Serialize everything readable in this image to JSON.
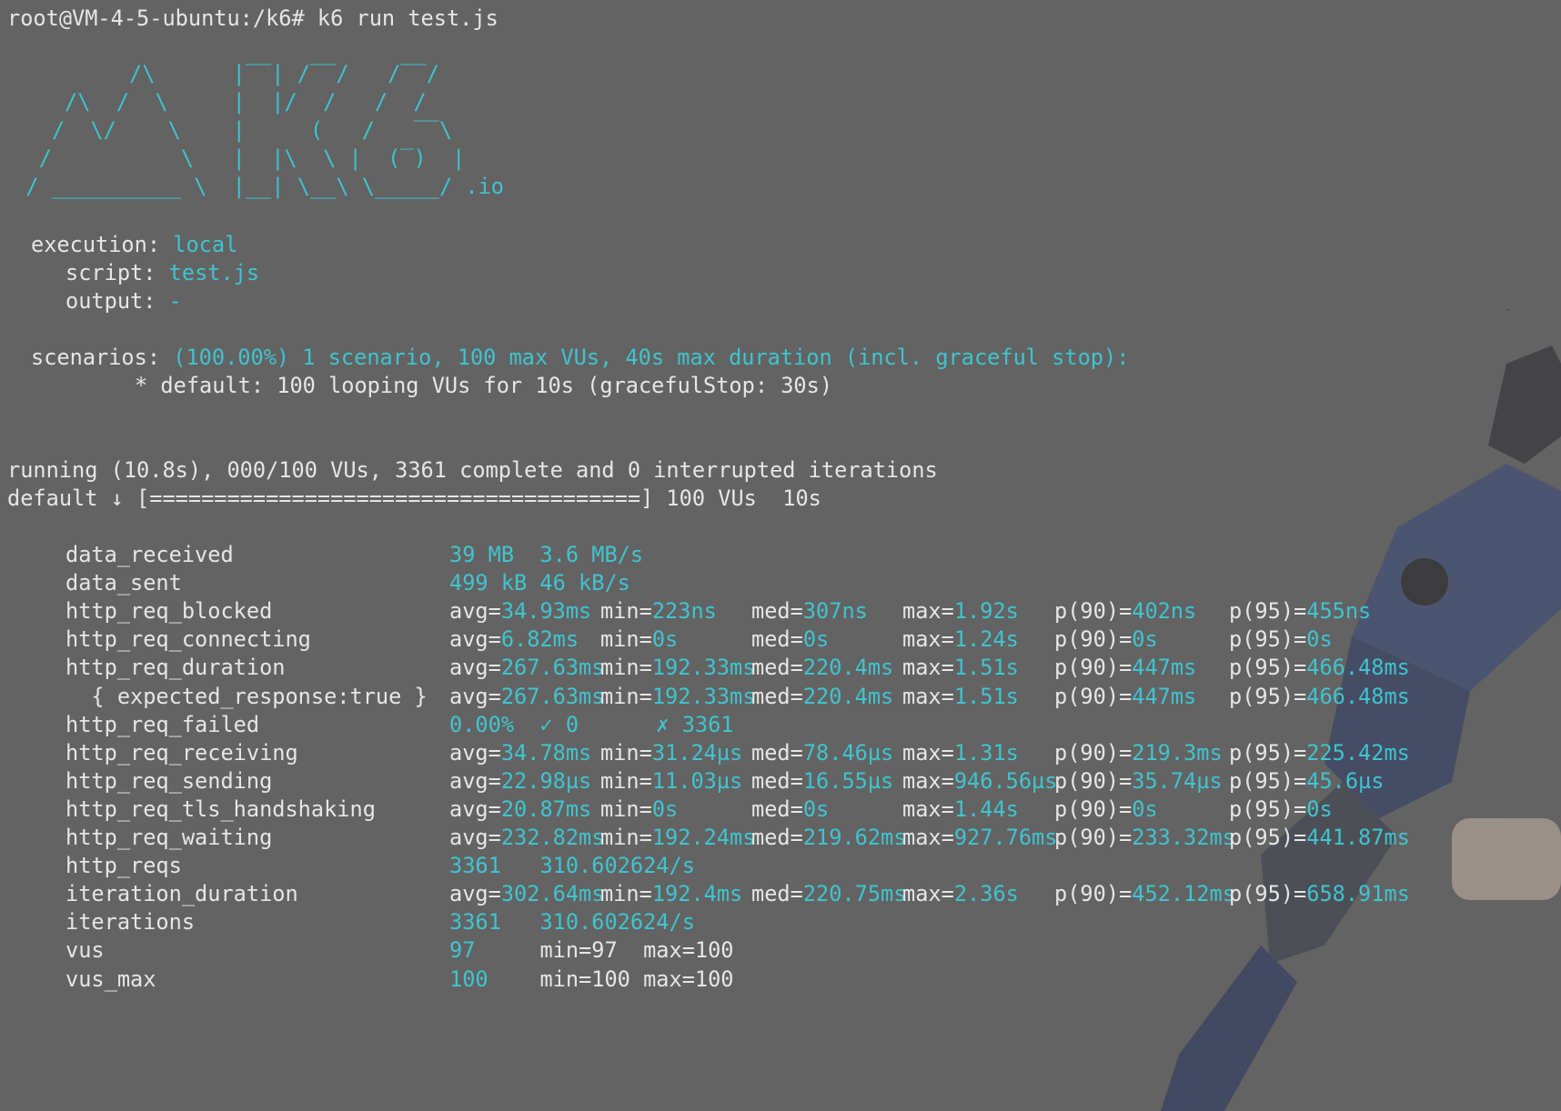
{
  "colors": {
    "background": "#636363",
    "text": "#e6e6e6",
    "accent": "#3fc4cf",
    "link": "#3a86e0"
  },
  "prompt": {
    "text": "root@VM-4-5-ubuntu:/k6# k6 run test.js"
  },
  "logo": {
    "lines": [
      "          /\\      |‾‾| /‾‾/   /‾‾/",
      "     /\\  /  \\     |  |/  /   /  /",
      "    /  \\/    \\    |     (   /   ‾‾\\",
      "   /          \\   |  |\\  \\ |  (‾)  |",
      "  / __________ \\  |__| \\__\\ \\_____/ .io"
    ]
  },
  "execution": {
    "execution_label": "execution:",
    "execution_value": "local",
    "script_label": "script:",
    "script_value": "test.js",
    "output_label": "output:",
    "output_value": "-"
  },
  "scenarios": {
    "label": "scenarios:",
    "summary": "(100.00%) 1 scenario, 100 max VUs, 40s max duration (incl. graceful stop):",
    "detail": "* default: 100 looping VUs for 10s (gracefulStop: 30s)"
  },
  "progress": {
    "running": "running (10.8s), 000/100 VUs, 3361 complete and 0 interrupted iterations",
    "default_line": "default ↓ [======================================] 100 VUs  10s"
  },
  "metrics": [
    {
      "name": "data_received",
      "parts": [
        {
          "t": "39 MB  3.6 MB/s",
          "c": 1
        }
      ]
    },
    {
      "name": "data_sent",
      "parts": [
        {
          "t": "499 kB 46 kB/s",
          "c": 1
        }
      ]
    },
    {
      "name": "http_req_blocked",
      "cols": [
        {
          "k": "avg=",
          "v": "34.93ms"
        },
        {
          "k": "min=",
          "v": "223ns"
        },
        {
          "k": "med=",
          "v": "307ns"
        },
        {
          "k": "max=",
          "v": "1.92s"
        },
        {
          "k": "p(90)=",
          "v": "402ns"
        },
        {
          "k": "p(95)=",
          "v": "455ns"
        }
      ]
    },
    {
      "name": "http_req_connecting",
      "cols": [
        {
          "k": "avg=",
          "v": "6.82ms"
        },
        {
          "k": "min=",
          "v": "0s"
        },
        {
          "k": "med=",
          "v": "0s"
        },
        {
          "k": "max=",
          "v": "1.24s"
        },
        {
          "k": "p(90)=",
          "v": "0s"
        },
        {
          "k": "p(95)=",
          "v": "0s"
        }
      ]
    },
    {
      "name": "http_req_duration",
      "cols": [
        {
          "k": "avg=",
          "v": "267.63ms"
        },
        {
          "k": "min=",
          "v": "192.33ms"
        },
        {
          "k": "med=",
          "v": "220.4ms"
        },
        {
          "k": "max=",
          "v": "1.51s"
        },
        {
          "k": "p(90)=",
          "v": "447ms"
        },
        {
          "k": "p(95)=",
          "v": "466.48ms"
        }
      ]
    },
    {
      "name": "  { expected_response:true }",
      "cols": [
        {
          "k": "avg=",
          "v": "267.63ms"
        },
        {
          "k": "min=",
          "v": "192.33ms"
        },
        {
          "k": "med=",
          "v": "220.4ms"
        },
        {
          "k": "max=",
          "v": "1.51s"
        },
        {
          "k": "p(90)=",
          "v": "447ms"
        },
        {
          "k": "p(95)=",
          "v": "466.48ms"
        }
      ]
    },
    {
      "name": "http_req_failed",
      "parts": [
        {
          "t": "0.00%",
          "c": 1
        },
        {
          "t": "  ✓ 0      ✗ 3361",
          "c": 2
        }
      ]
    },
    {
      "name": "http_req_receiving",
      "cols": [
        {
          "k": "avg=",
          "v": "34.78ms"
        },
        {
          "k": "min=",
          "v": "31.24µs"
        },
        {
          "k": "med=",
          "v": "78.46µs"
        },
        {
          "k": "max=",
          "v": "1.31s"
        },
        {
          "k": "p(90)=",
          "v": "219.3ms"
        },
        {
          "k": "p(95)=",
          "v": "225.42ms"
        }
      ]
    },
    {
      "name": "http_req_sending",
      "cols": [
        {
          "k": "avg=",
          "v": "22.98µs"
        },
        {
          "k": "min=",
          "v": "11.03µs"
        },
        {
          "k": "med=",
          "v": "16.55µs"
        },
        {
          "k": "max=",
          "v": "946.56µs"
        },
        {
          "k": "p(90)=",
          "v": "35.74µs"
        },
        {
          "k": "p(95)=",
          "v": "45.6µs"
        }
      ]
    },
    {
      "name": "http_req_tls_handshaking",
      "cols": [
        {
          "k": "avg=",
          "v": "20.87ms"
        },
        {
          "k": "min=",
          "v": "0s"
        },
        {
          "k": "med=",
          "v": "0s"
        },
        {
          "k": "max=",
          "v": "1.44s"
        },
        {
          "k": "p(90)=",
          "v": "0s"
        },
        {
          "k": "p(95)=",
          "v": "0s"
        }
      ]
    },
    {
      "name": "http_req_waiting",
      "cols": [
        {
          "k": "avg=",
          "v": "232.82ms"
        },
        {
          "k": "min=",
          "v": "192.24ms"
        },
        {
          "k": "med=",
          "v": "219.62ms"
        },
        {
          "k": "max=",
          "v": "927.76ms"
        },
        {
          "k": "p(90)=",
          "v": "233.32ms"
        },
        {
          "k": "p(95)=",
          "v": "441.87ms"
        }
      ]
    },
    {
      "name": "http_reqs",
      "parts": [
        {
          "t": "3361",
          "c": 1
        },
        {
          "t": "   310.602624/s",
          "c": 1
        }
      ]
    },
    {
      "name": "iteration_duration",
      "cols": [
        {
          "k": "avg=",
          "v": "302.64ms"
        },
        {
          "k": "min=",
          "v": "192.4ms"
        },
        {
          "k": "med=",
          "v": "220.75ms"
        },
        {
          "k": "max=",
          "v": "2.36s"
        },
        {
          "k": "p(90)=",
          "v": "452.12ms"
        },
        {
          "k": "p(95)=",
          "v": "658.91ms"
        }
      ]
    },
    {
      "name": "iterations",
      "parts": [
        {
          "t": "3361",
          "c": 1
        },
        {
          "t": "   310.602624/s",
          "c": 1
        }
      ]
    },
    {
      "name": "vus",
      "parts": [
        {
          "t": "97",
          "c": 1
        },
        {
          "t": "     min=97  max=100",
          "c": 0
        }
      ]
    },
    {
      "name": "vus_max",
      "parts": [
        {
          "t": "100",
          "c": 1
        },
        {
          "t": "    min=100 max=100",
          "c": 0
        }
      ]
    }
  ]
}
